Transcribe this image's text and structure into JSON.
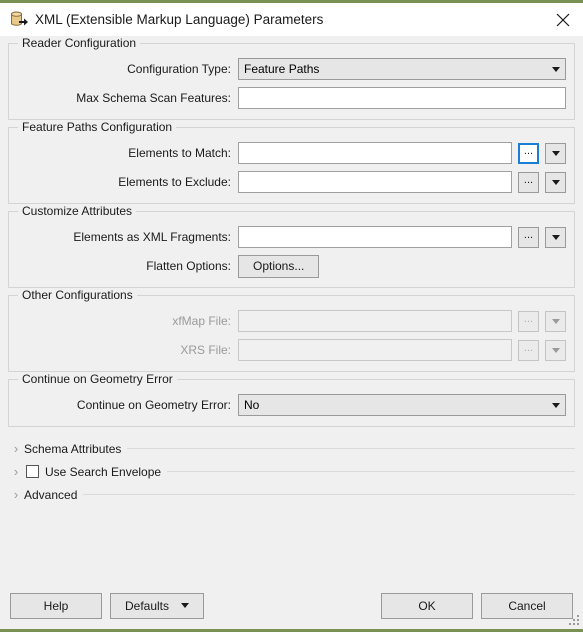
{
  "window": {
    "title": "XML (Extensible Markup Language) Parameters",
    "icon": "xml-reader-icon",
    "close_icon": "close-icon",
    "accent_border": "#7a9156",
    "focus_color": "#1a7fd4"
  },
  "groups": [
    {
      "title": "Reader Configuration",
      "rows": [
        {
          "label": "Configuration Type:",
          "type": "combo",
          "value": "Feature Paths",
          "disabled": false,
          "has_dots": false,
          "has_caret_button": false
        },
        {
          "label": "Max Schema Scan Features:",
          "type": "text",
          "value": "",
          "placeholder": "",
          "disabled": false,
          "has_dots": false,
          "has_caret_button": false
        }
      ]
    },
    {
      "title": "Feature Paths Configuration",
      "rows": [
        {
          "label": "Elements to Match:",
          "type": "text",
          "value": "",
          "placeholder": "",
          "disabled": false,
          "has_dots": true,
          "dots_label": "...",
          "dots_focused": true,
          "has_caret_button": true
        },
        {
          "label": "Elements to Exclude:",
          "type": "text",
          "value": "",
          "placeholder": "",
          "disabled": false,
          "has_dots": true,
          "dots_label": "...",
          "dots_focused": false,
          "has_caret_button": true
        }
      ]
    },
    {
      "title": "Customize Attributes",
      "rows": [
        {
          "label": "Elements as XML Fragments:",
          "type": "text",
          "value": "",
          "placeholder": "",
          "disabled": false,
          "has_dots": true,
          "dots_label": "...",
          "dots_focused": false,
          "has_caret_button": true
        },
        {
          "label": "Flatten Options:",
          "type": "button",
          "value": "Options...",
          "disabled": false,
          "has_dots": false,
          "has_caret_button": false
        }
      ]
    },
    {
      "title": "Other Configurations",
      "rows": [
        {
          "label": "xfMap File:",
          "type": "text",
          "value": "",
          "placeholder": "",
          "disabled": true,
          "has_dots": true,
          "dots_label": "...",
          "dots_focused": false,
          "has_caret_button": true
        },
        {
          "label": "XRS File:",
          "type": "text",
          "value": "",
          "placeholder": "",
          "disabled": true,
          "has_dots": true,
          "dots_label": "...",
          "dots_focused": false,
          "has_caret_button": true
        }
      ]
    },
    {
      "title": "Continue on Geometry Error",
      "rows": [
        {
          "label": "Continue on Geometry Error:",
          "type": "combo",
          "value": "No",
          "disabled": false,
          "has_dots": false,
          "has_caret_button": false
        }
      ]
    }
  ],
  "collapsibles": [
    {
      "label": "Schema Attributes",
      "chevron": "chevron-right-icon",
      "has_checkbox": false,
      "checked": false
    },
    {
      "label": "Use Search Envelope",
      "chevron": "chevron-right-icon",
      "has_checkbox": true,
      "checked": false
    },
    {
      "label": "Advanced",
      "chevron": "chevron-right-icon",
      "has_checkbox": false,
      "checked": false
    }
  ],
  "footer": {
    "help_label": "Help",
    "defaults_label": "Defaults",
    "ok_label": "OK",
    "cancel_label": "Cancel",
    "resize_grip": "resize-grip-icon"
  }
}
